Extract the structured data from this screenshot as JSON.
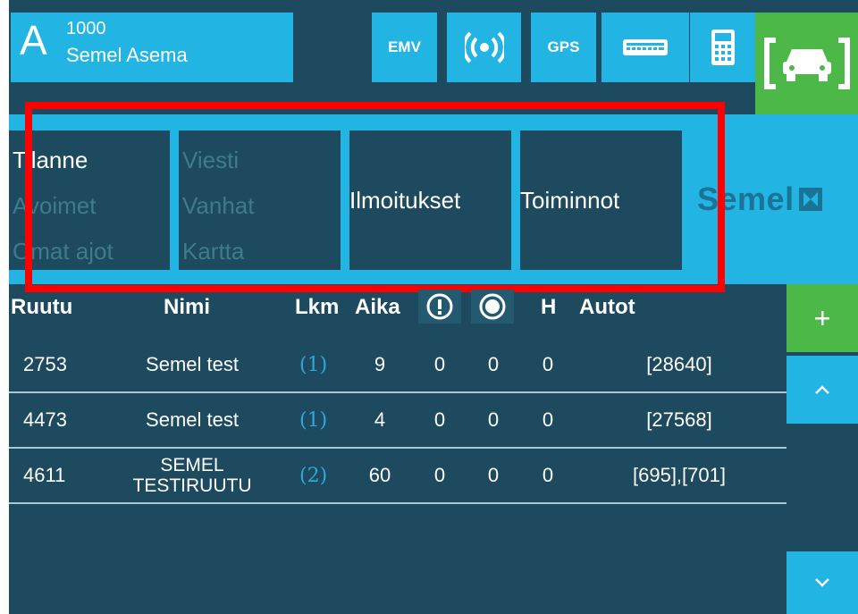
{
  "header": {
    "zone_letter": "A",
    "station_number": "1000",
    "station_name": "Semel Asema",
    "buttons": {
      "emv": "EMV",
      "gps": "GPS"
    }
  },
  "menu": {
    "group1": [
      "Tilanne",
      "Avoimet",
      "Omat ajot"
    ],
    "group2": [
      "Viesti",
      "Vanhat",
      "Kartta"
    ],
    "notifications": "Ilmoitukset",
    "actions": "Toiminnot"
  },
  "brand": {
    "logo_text": "Semel"
  },
  "table": {
    "headers": {
      "ruutu": "Ruutu",
      "nimi": "Nimi",
      "lkm": "Lkm",
      "aika": "Aika",
      "h": "H",
      "autot": "Autot"
    },
    "rows": [
      {
        "ruutu": "2753",
        "nimi_line1": "Semel test",
        "nimi_line2": "",
        "lkm": "(1)",
        "aika": "9",
        "c1": "0",
        "c2": "0",
        "h": "0",
        "autot": "[28640]"
      },
      {
        "ruutu": "4473",
        "nimi_line1": "Semel test",
        "nimi_line2": "",
        "lkm": "(1)",
        "aika": "4",
        "c1": "0",
        "c2": "0",
        "h": "0",
        "autot": "[27568]"
      },
      {
        "ruutu": "4611",
        "nimi_line1": "SEMEL",
        "nimi_line2": "TESTIRUUTU",
        "lkm": "(2)",
        "aika": "60",
        "c1": "0",
        "c2": "0",
        "h": "0",
        "autot": "[695],[701]"
      }
    ]
  },
  "colors": {
    "dark": "#1d4a5e",
    "accent": "#22b5e3",
    "green": "#4cb848",
    "highlight": "#ff0000"
  },
  "icons": [
    "wireless-icon",
    "keyboard-icon",
    "calculator-icon",
    "taxi-icon",
    "alert-icon",
    "target-icon",
    "plus-icon",
    "chevron-up-icon",
    "chevron-down-icon"
  ]
}
